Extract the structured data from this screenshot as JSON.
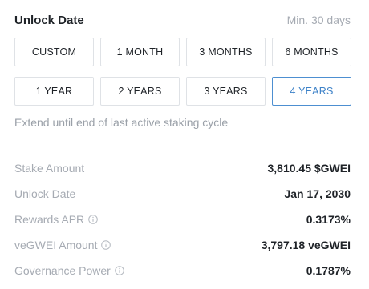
{
  "header": {
    "title": "Unlock Date",
    "min_label": "Min. 30 days"
  },
  "periods": [
    {
      "label": "CUSTOM",
      "selected": false
    },
    {
      "label": "1 MONTH",
      "selected": false
    },
    {
      "label": "3 MONTHS",
      "selected": false
    },
    {
      "label": "6 MONTHS",
      "selected": false
    },
    {
      "label": "1 YEAR",
      "selected": false
    },
    {
      "label": "2 YEARS",
      "selected": false
    },
    {
      "label": "3 YEARS",
      "selected": false
    },
    {
      "label": "4 YEARS",
      "selected": true
    }
  ],
  "note": "Extend until end of last active staking cycle",
  "stats": [
    {
      "label": "Stake Amount",
      "value": "3,810.45 $GWEI",
      "info_icon": false
    },
    {
      "label": "Unlock Date",
      "value": "Jan 17, 2030",
      "info_icon": false
    },
    {
      "label": "Rewards APR",
      "value": "0.3173%",
      "info_icon": true
    },
    {
      "label": "veGWEI Amount",
      "value": "3,797.18 veGWEI",
      "info_icon": true
    },
    {
      "label": "Governance Power",
      "value": "0.1787%",
      "info_icon": true
    }
  ],
  "colors": {
    "accent": "#3d82c8",
    "muted_text": "#a6abb3",
    "border": "#dfe2e6"
  },
  "icons": {
    "info": "info-circle-icon"
  }
}
